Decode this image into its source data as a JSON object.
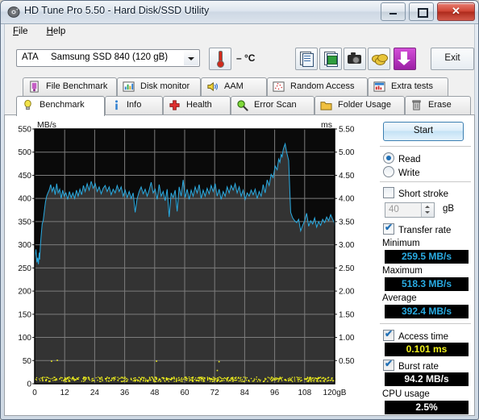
{
  "window": {
    "title": "HD Tune Pro 5.50 - Hard Disk/SSD Utility",
    "icon": "hdtune-app-icon",
    "minimize_label": "",
    "maximize_label": "",
    "close_label": "✕"
  },
  "menu": {
    "items": [
      {
        "label": "File",
        "accel": "F"
      },
      {
        "label": "Help",
        "accel": "H"
      }
    ]
  },
  "toolbar": {
    "drive": {
      "interface": "ATA",
      "name": "Samsung SSD 840 (120 gB)"
    },
    "temperature": "– °C",
    "buttons": [
      {
        "name": "copy-text-icon",
        "label": ""
      },
      {
        "name": "copy-image-icon",
        "label": ""
      },
      {
        "name": "screenshot-icon",
        "label": ""
      },
      {
        "name": "donate-icon",
        "label": ""
      },
      {
        "name": "download-icon",
        "label": ""
      }
    ],
    "exit_label": "Exit"
  },
  "tabs": {
    "row1": [
      {
        "label": "File Benchmark",
        "icon": "file-benchmark-icon",
        "active": false
      },
      {
        "label": "Disk monitor",
        "icon": "disk-monitor-icon",
        "active": false
      },
      {
        "label": "AAM",
        "icon": "aam-speaker-icon",
        "active": false
      },
      {
        "label": "Random Access",
        "icon": "random-access-icon",
        "active": false
      },
      {
        "label": "Extra tests",
        "icon": "extra-tests-icon",
        "active": false
      }
    ],
    "row2": [
      {
        "label": "Benchmark",
        "icon": "benchmark-bulb-icon",
        "active": true
      },
      {
        "label": "Info",
        "icon": "info-icon",
        "active": false
      },
      {
        "label": "Health",
        "icon": "health-cross-icon",
        "active": false
      },
      {
        "label": "Error Scan",
        "icon": "error-scan-magnifier-icon",
        "active": false
      },
      {
        "label": "Folder Usage",
        "icon": "folder-usage-icon",
        "active": false
      },
      {
        "label": "Erase",
        "icon": "erase-trash-icon",
        "active": false
      }
    ]
  },
  "controls": {
    "start_label": "Start",
    "mode": [
      {
        "label": "Read",
        "selected": true
      },
      {
        "label": "Write",
        "selected": false
      }
    ],
    "short_stroke": {
      "label": "Short stroke",
      "checked": false
    },
    "short_stroke_value": "40",
    "short_stroke_unit": "gB",
    "transfer_rate": {
      "label": "Transfer rate",
      "checked": true
    },
    "stats": [
      {
        "label": "Minimum",
        "value": "259.5 MB/s",
        "color": "#29ABE2"
      },
      {
        "label": "Maximum",
        "value": "518.3 MB/s",
        "color": "#29ABE2"
      },
      {
        "label": "Average",
        "value": "392.4 MB/s",
        "color": "#29ABE2"
      }
    ],
    "access_time": {
      "label": "Access time",
      "checked": true,
      "value": "0.101 ms",
      "color": "#f2f21c"
    },
    "burst_rate": {
      "label": "Burst rate",
      "checked": true,
      "value": "94.2 MB/s",
      "color": "#ffffff"
    },
    "cpu_usage": {
      "label": "CPU usage",
      "value": "2.5%",
      "color": "#ffffff"
    }
  },
  "chart_data": {
    "type": "line",
    "title": "",
    "xlabel": "120gB",
    "ylabel": "MB/s",
    "y2label": "ms",
    "xlim": [
      0,
      120
    ],
    "ylim": [
      0,
      550
    ],
    "y2lim": [
      0,
      5.5
    ],
    "grid": true,
    "xticks": [
      0,
      12,
      24,
      36,
      48,
      60,
      72,
      84,
      96,
      108,
      120
    ],
    "xtick_labels": [
      "0",
      "12",
      "24",
      "36",
      "48",
      "60",
      "72",
      "84",
      "96",
      "108",
      "120gB"
    ],
    "yticks": [
      0,
      50,
      100,
      150,
      200,
      250,
      300,
      350,
      400,
      450,
      500,
      550
    ],
    "y2ticks": [
      0.5,
      1.0,
      1.5,
      2.0,
      2.5,
      3.0,
      3.5,
      4.0,
      4.5,
      5.0,
      5.5
    ],
    "y2tick_labels": [
      "0.50",
      "1.00",
      "1.50",
      "2.00",
      "2.50",
      "3.00",
      "3.50",
      "4.00",
      "4.50",
      "5.00",
      "5.50"
    ],
    "series": [
      {
        "name": "Transfer rate",
        "color": "#29ABE2",
        "axis": "left",
        "x": [
          0.0,
          0.5,
          0.9,
          1.2,
          1.5,
          1.8,
          2.0,
          2.3,
          2.6,
          3.0,
          3.4,
          3.8,
          4.3,
          4.8,
          5.3,
          5.8,
          6.4,
          7.0,
          7.6,
          8.2,
          8.8,
          9.4,
          10.0,
          10.6,
          11.2,
          11.8,
          12.5,
          13.2,
          13.9,
          14.6,
          15.3,
          16.0,
          16.7,
          17.4,
          18.1,
          18.8,
          19.5,
          20.2,
          21.0,
          21.8,
          22.6,
          23.4,
          24.2,
          25.0,
          25.8,
          26.6,
          27.4,
          28.2,
          29.0,
          29.8,
          30.6,
          31.4,
          32.2,
          33.0,
          33.8,
          34.6,
          35.4,
          36.2,
          37.0,
          37.8,
          38.6,
          39.4,
          40.2,
          41.0,
          41.8,
          42.6,
          43.4,
          44.2,
          45.0,
          45.8,
          46.6,
          47.4,
          48.2,
          49.0,
          49.8,
          50.6,
          51.4,
          52.2,
          53.0,
          53.8,
          54.6,
          55.4,
          56.2,
          57.0,
          57.8,
          58.6,
          59.4,
          60.2,
          61.0,
          61.8,
          62.6,
          63.4,
          64.2,
          65.0,
          65.8,
          66.6,
          67.4,
          68.2,
          69.0,
          69.8,
          70.6,
          71.4,
          72.2,
          73.0,
          73.8,
          74.6,
          75.4,
          76.2,
          77.0,
          77.8,
          78.6,
          79.4,
          80.2,
          81.0,
          81.8,
          82.6,
          83.4,
          84.2,
          85.0,
          85.8,
          86.6,
          87.4,
          88.2,
          89.0,
          89.8,
          90.6,
          91.4,
          92.2,
          93.0,
          93.8,
          94.6,
          95.4,
          96.2,
          97.0,
          97.6,
          98.1,
          98.6,
          99.0,
          99.4,
          99.8,
          100.2,
          100.8,
          101.6,
          102.4,
          103.2,
          104.0,
          104.8,
          105.6,
          106.4,
          107.2,
          108.0,
          108.8,
          109.6,
          110.4,
          111.2,
          112.0,
          112.8,
          113.6,
          114.4,
          115.2,
          116.0,
          116.8,
          117.6,
          118.4,
          119.2,
          119.8,
          120.0
        ],
        "y": [
          268,
          290,
          262,
          272,
          258,
          283,
          268,
          300,
          320,
          345,
          352,
          370,
          392,
          405,
          412,
          418,
          430,
          415,
          425,
          408,
          432,
          412,
          420,
          400,
          418,
          405,
          412,
          398,
          415,
          402,
          412,
          400,
          418,
          405,
          420,
          408,
          428,
          415,
          432,
          418,
          437,
          422,
          432,
          415,
          425,
          410,
          422,
          428,
          415,
          425,
          408,
          420,
          412,
          428,
          415,
          425,
          405,
          418,
          402,
          415,
          400,
          412,
          370,
          400,
          415,
          425,
          410,
          420,
          405,
          418,
          435,
          412,
          420,
          398,
          430,
          405,
          415,
          395,
          420,
          360,
          412,
          402,
          418,
          372,
          425,
          405,
          440,
          402,
          420,
          398,
          418,
          405,
          425,
          412,
          430,
          400,
          418,
          405,
          422,
          410,
          428,
          415,
          432,
          405,
          420,
          398,
          415,
          405,
          425,
          412,
          428,
          418,
          432,
          412,
          425,
          405,
          418,
          398,
          412,
          405,
          418,
          408,
          420,
          400,
          415,
          405,
          430,
          412,
          440,
          428,
          452,
          445,
          470,
          462,
          485,
          478,
          495,
          490,
          505,
          512,
          518,
          500,
          482,
          370,
          358,
          352,
          348,
          355,
          330,
          342,
          352,
          368,
          340,
          352,
          345,
          358,
          338,
          350,
          342,
          355,
          348,
          360,
          352,
          365,
          355,
          348,
          340,
          358,
          352,
          345,
          292,
          278
        ]
      },
      {
        "name": "Access time",
        "color": "#f2f21c",
        "axis": "right",
        "description": "dense band of points near 0.10 ms across the full capacity, with sparse outliers near 0.45-0.55 ms",
        "baseline_ms": 0.101,
        "outliers": [
          {
            "x": 6.5,
            "ms": 0.5
          },
          {
            "x": 8.8,
            "ms": 0.52
          },
          {
            "x": 48.5,
            "ms": 0.5
          },
          {
            "x": 73.5,
            "ms": 0.49
          },
          {
            "x": 72.8,
            "ms": 0.3
          }
        ]
      }
    ]
  }
}
